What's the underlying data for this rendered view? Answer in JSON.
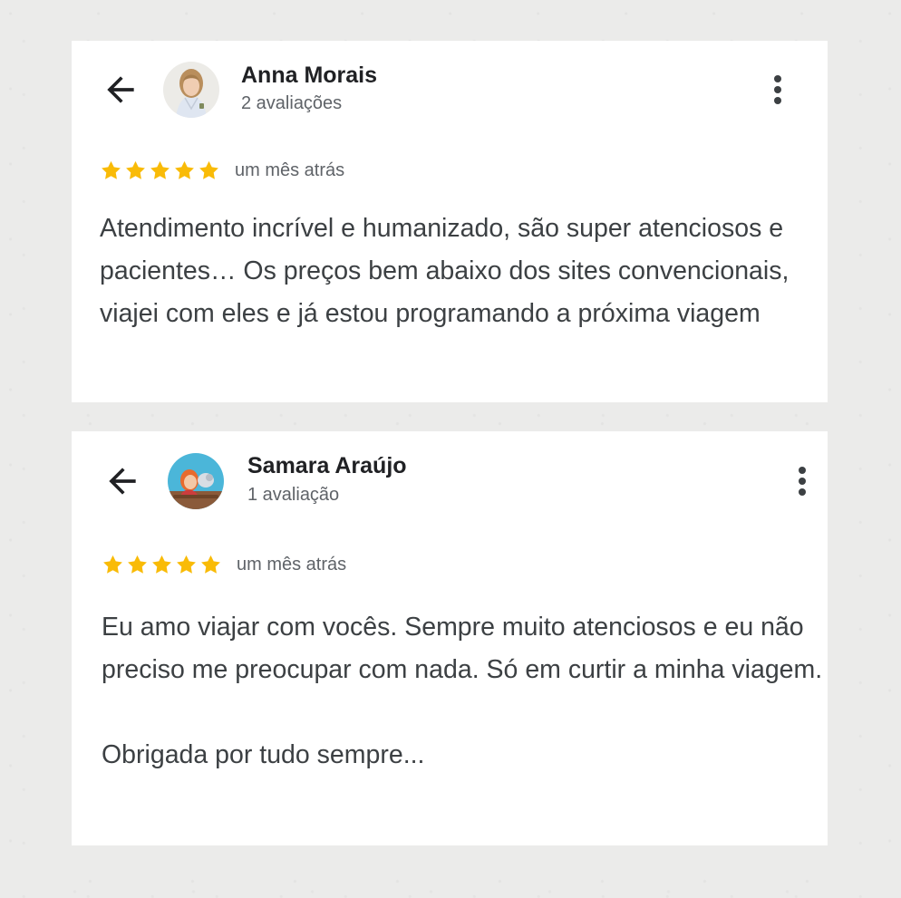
{
  "colors": {
    "star": "#f9bb07",
    "name": "#202124",
    "secondary": "#5f6368",
    "body_text": "#3c4043",
    "card_background": "#ffffff"
  },
  "icons": {
    "back": "arrow-left-icon",
    "more": "more-vert-icon",
    "star": "star-filled-icon"
  },
  "reviews": [
    {
      "author": "Anna Morais",
      "review_count": "2 avaliações",
      "rating": 5,
      "rating_max": 5,
      "date": "um mês atrás",
      "text": [
        "Atendimento incrível e humanizado, são super atenciosos e pacientes… Os preços bem abaixo dos sites convencionais, viajei com eles e já estou programando a próxima viagem"
      ]
    },
    {
      "author": "Samara Araújo",
      "review_count": "1 avaliação",
      "rating": 5,
      "rating_max": 5,
      "date": "um mês atrás",
      "text": [
        "Eu amo viajar com vocês. Sempre muito atenciosos e eu não preciso me preocupar com nada. Só em curtir a minha viagem.",
        "Obrigada por tudo sempre..."
      ]
    }
  ]
}
